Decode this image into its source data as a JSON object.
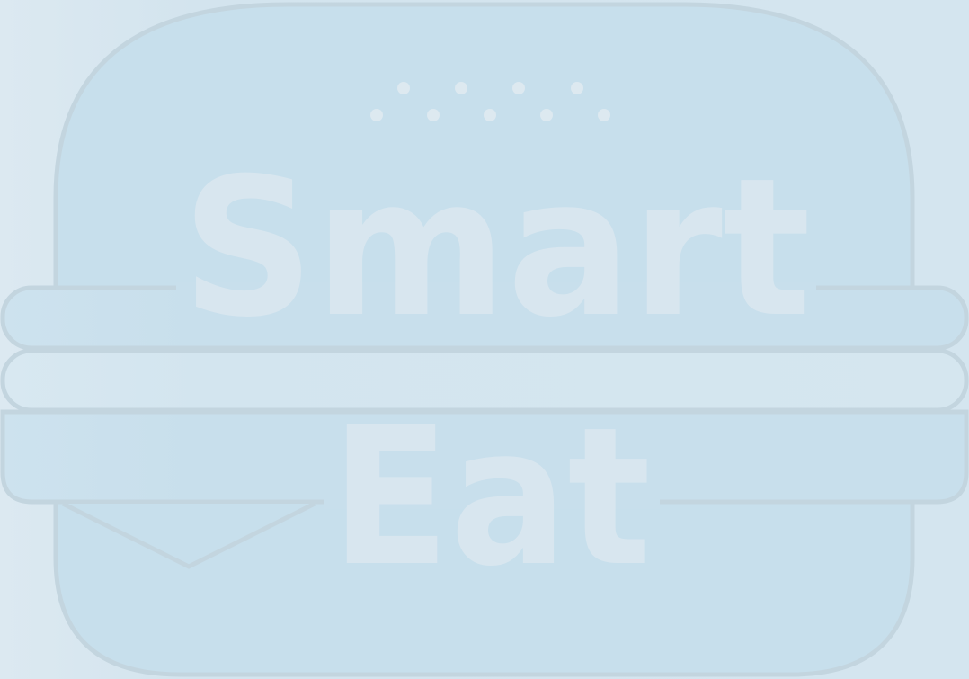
{
  "logo": {
    "line1": "Smart",
    "line2": "Eat",
    "icon": "burger-icon"
  },
  "colors": {
    "background": "#d6e6ef",
    "bun_fill": "#c7dfec",
    "outline": "#c3d5df",
    "letters": "#d8e6ef",
    "seeds": "#dde9f0",
    "patty_fill": "#d4e5ef"
  }
}
